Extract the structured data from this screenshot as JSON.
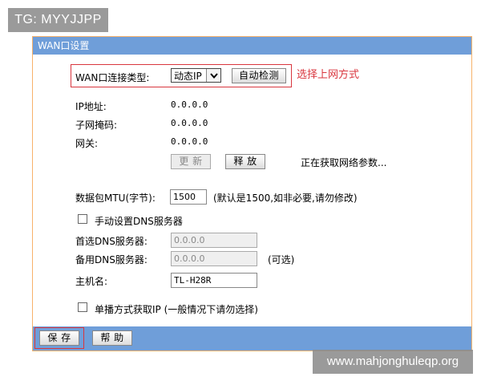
{
  "watermarks": {
    "top": "TG: MYYJJPP",
    "bottom": "www.mahjonghuleqp.org"
  },
  "panel": {
    "title": "WAN口设置"
  },
  "wan_type": {
    "label": "WAN口连接类型:",
    "selected": "动态IP",
    "detect_button": "自动检测",
    "annotation": "选择上网方式"
  },
  "status": {
    "ip_label": "IP地址:",
    "ip_value": "0.0.0.0",
    "mask_label": "子网掩码:",
    "mask_value": "0.0.0.0",
    "gateway_label": "网关:",
    "gateway_value": "0.0.0.0",
    "gateway_value2": "0.0.0.0",
    "renew_button": "更 新",
    "release_button": "释 放",
    "message": "正在获取网络参数..."
  },
  "mtu": {
    "label": "数据包MTU(字节):",
    "value": "1500",
    "hint": "(默认是1500,如非必要,请勿修改)"
  },
  "dns": {
    "manual_label": "手动设置DNS服务器",
    "manual_checked": false,
    "primary_label": "首选DNS服务器:",
    "primary_value": "0.0.0.0",
    "secondary_label": "备用DNS服务器:",
    "secondary_value": "0.0.0.0",
    "secondary_hint": "(可选)"
  },
  "hostname": {
    "label": "主机名:",
    "value": "TL-H28R"
  },
  "unicast": {
    "label": "单播方式获取IP  (一般情况下请勿选择)",
    "checked": false
  },
  "footer": {
    "save_button": "保 存",
    "help_button": "帮 助"
  },
  "colors": {
    "header": "#6f9ed9",
    "border": "#f7b26a",
    "highlight": "#d9363e"
  }
}
